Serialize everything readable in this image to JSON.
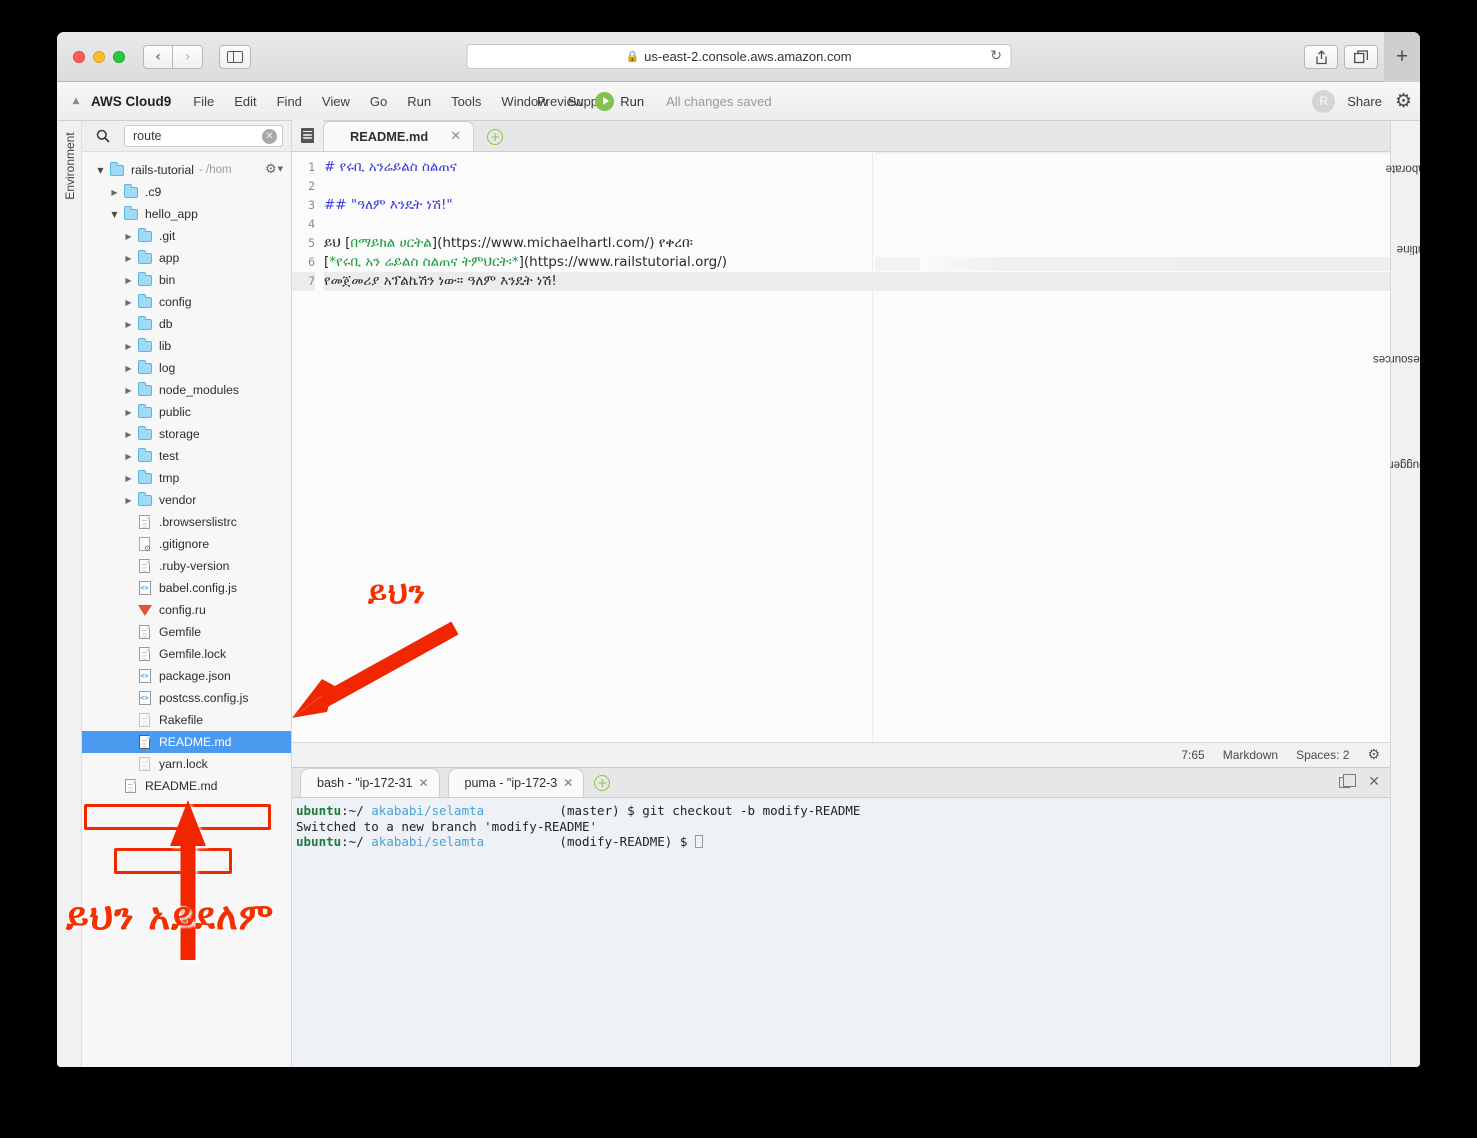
{
  "browser": {
    "url": "us-east-2.console.aws.amazon.com",
    "lock_icon": "lock-icon",
    "reload_icon": "reload-icon",
    "back_icon": "chevron-left-icon",
    "forward_icon": "chevron-right-icon",
    "sidebar_icon": "sidebar-toggle-icon",
    "share_icon": "share-icon",
    "tabs_icon": "show-tabs-icon",
    "new_tab_icon": "plus-icon"
  },
  "menubar": {
    "collapse_icon": "triangle-up-icon",
    "brand": "AWS Cloud9",
    "items": [
      "File",
      "Edit",
      "Find",
      "View",
      "Go",
      "Run",
      "Tools",
      "Window",
      "Support"
    ],
    "preview": "Preview",
    "run": "Run",
    "run_icon": "play-icon",
    "status": "All changes saved",
    "avatar_letter": "R",
    "share": "Share",
    "settings_icon": "gear-icon"
  },
  "env_strip": {
    "label": "Environment"
  },
  "search": {
    "icon": "search-icon",
    "value": "route",
    "placeholder": "",
    "clear_icon": "clear-icon"
  },
  "tree": {
    "root": {
      "name": "rails-tutorial",
      "path": "- /hom",
      "gear_icon": "gear-icon"
    },
    "items": [
      {
        "label": ".c9",
        "type": "folder",
        "depth": 1,
        "open": false
      },
      {
        "label": "hello_app",
        "type": "folder",
        "depth": 1,
        "open": true
      },
      {
        "label": ".git",
        "type": "folder",
        "depth": 2,
        "open": false
      },
      {
        "label": "app",
        "type": "folder",
        "depth": 2,
        "open": false
      },
      {
        "label": "bin",
        "type": "folder",
        "depth": 2,
        "open": false
      },
      {
        "label": "config",
        "type": "folder",
        "depth": 2,
        "open": false
      },
      {
        "label": "db",
        "type": "folder",
        "depth": 2,
        "open": false
      },
      {
        "label": "lib",
        "type": "folder",
        "depth": 2,
        "open": false
      },
      {
        "label": "log",
        "type": "folder",
        "depth": 2,
        "open": false
      },
      {
        "label": "node_modules",
        "type": "folder",
        "depth": 2,
        "open": false
      },
      {
        "label": "public",
        "type": "folder",
        "depth": 2,
        "open": false
      },
      {
        "label": "storage",
        "type": "folder",
        "depth": 2,
        "open": false
      },
      {
        "label": "test",
        "type": "folder",
        "depth": 2,
        "open": false
      },
      {
        "label": "tmp",
        "type": "folder",
        "depth": 2,
        "open": false
      },
      {
        "label": "vendor",
        "type": "folder",
        "depth": 2,
        "open": false
      },
      {
        "label": ".browserslistrc",
        "type": "doc",
        "depth": 2
      },
      {
        "label": ".gitignore",
        "type": "gitignore",
        "depth": 2
      },
      {
        "label": ".ruby-version",
        "type": "doc",
        "depth": 2
      },
      {
        "label": "babel.config.js",
        "type": "js",
        "depth": 2
      },
      {
        "label": "config.ru",
        "type": "ruby",
        "depth": 2
      },
      {
        "label": "Gemfile",
        "type": "doc",
        "depth": 2
      },
      {
        "label": "Gemfile.lock",
        "type": "doc",
        "depth": 2
      },
      {
        "label": "package.json",
        "type": "js",
        "depth": 2
      },
      {
        "label": "postcss.config.js",
        "type": "js",
        "depth": 2
      },
      {
        "label": "Rakefile",
        "type": "doc",
        "depth": 2
      },
      {
        "label": "README.md",
        "type": "doc",
        "depth": 2,
        "selected": true
      },
      {
        "label": "yarn.lock",
        "type": "doc",
        "depth": 2
      },
      {
        "label": "README.md",
        "type": "doc",
        "depth": 1
      }
    ]
  },
  "editor": {
    "tab_icon": "document-list-icon",
    "tab_label": "README.md",
    "tab_close_icon": "close-icon",
    "add_tab_icon": "plus-circle-icon",
    "lines": [
      {
        "n": "1",
        "segments": [
          {
            "cls": "hdr",
            "t": "# የሩቢ አንሬይልስ ስልጠና"
          }
        ]
      },
      {
        "n": "2",
        "segments": [
          {
            "cls": "txt",
            "t": ""
          }
        ]
      },
      {
        "n": "3",
        "segments": [
          {
            "cls": "hdr",
            "t": "## \"ዓለም እንዴት ነሽ!\""
          }
        ]
      },
      {
        "n": "4",
        "segments": [
          {
            "cls": "txt",
            "t": ""
          }
        ]
      },
      {
        "n": "5",
        "segments": [
          {
            "cls": "txt",
            "t": "ይህ ["
          },
          {
            "cls": "lnk",
            "t": "በማይክል ሀርትል"
          },
          {
            "cls": "txt",
            "t": "](https://www.michaelhartl.com/) የቀረበ፡"
          }
        ]
      },
      {
        "n": "6",
        "segments": [
          {
            "cls": "txt",
            "t": "["
          },
          {
            "cls": "lnk",
            "t": "*የሩቢ አን ሬይልስ ስልጠና ትምህርት፡*"
          },
          {
            "cls": "txt",
            "t": "](https://www.railstutorial.org/)"
          }
        ]
      },
      {
        "n": "7",
        "segments": [
          {
            "cls": "txt",
            "t": "የመጀመሪያ አፕልኬሽን ነው። ዓለም እንዴት ነሽ!"
          }
        ],
        "active": true
      }
    ],
    "status": {
      "cursor": "7:65",
      "mode": "Markdown",
      "spaces": "Spaces: 2",
      "gear_icon": "gear-icon"
    }
  },
  "terminal": {
    "tabs": [
      {
        "label": "bash - \"ip-172-31",
        "close_icon": "close-icon"
      },
      {
        "label": "puma - \"ip-172-3",
        "close_icon": "close-icon"
      }
    ],
    "add_tab_icon": "plus-circle-icon",
    "maximize_icon": "restore-icon",
    "close_icon": "close-icon",
    "lines": [
      {
        "parts": [
          {
            "cls": "t-user",
            "t": "ubuntu"
          },
          {
            "cls": "",
            "t": ":~/ "
          },
          {
            "cls": "t-path",
            "t": "akababi/selamta"
          },
          {
            "cls": "",
            "t": "          (master) $ git checkout -b modify-README"
          }
        ]
      },
      {
        "parts": [
          {
            "cls": "",
            "t": "Switched to a new branch 'modify-README'"
          }
        ]
      },
      {
        "parts": [
          {
            "cls": "t-user",
            "t": "ubuntu"
          },
          {
            "cls": "",
            "t": ":~/ "
          },
          {
            "cls": "t-path",
            "t": "akababi/selamta"
          },
          {
            "cls": "",
            "t": "          (modify-README) $ "
          }
        ],
        "cursor": true
      }
    ]
  },
  "rail": {
    "items": [
      "Collaborate",
      "Outline",
      "AWS Resources",
      "Debugger"
    ]
  },
  "annotations": {
    "arrow1_label": "ይህን",
    "arrow2_label": "ይህን አይደለም",
    "color": "#f53000"
  }
}
